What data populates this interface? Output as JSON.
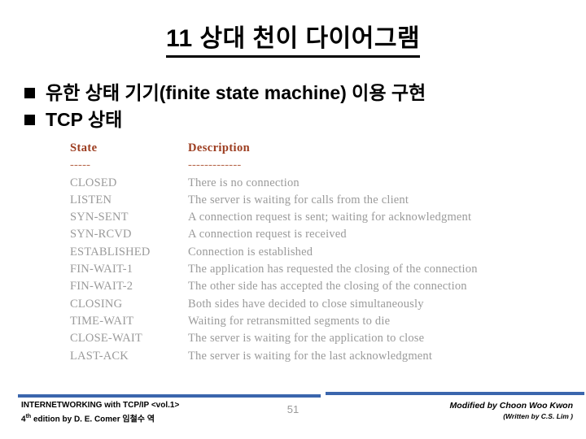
{
  "slide": {
    "title": "11 상대 천이 다이어그램"
  },
  "bullets": [
    {
      "marker": "square-bullet",
      "text": "유한 상태 기기(finite state machine) 이용 구현"
    },
    {
      "marker": "square-bullet",
      "text": "TCP 상태"
    }
  ],
  "table": {
    "headers": {
      "state": "State",
      "description": "Description"
    },
    "separators": {
      "state": "-----",
      "description": "-------------"
    },
    "rows": [
      {
        "state": "CLOSED",
        "description": "There is no connection"
      },
      {
        "state": "LISTEN",
        "description": "The server is waiting for calls from the client"
      },
      {
        "state": "SYN-SENT",
        "description": "A connection request is sent; waiting for acknowledgment"
      },
      {
        "state": "SYN-RCVD",
        "description": "A connection request is received"
      },
      {
        "state": "ESTABLISHED",
        "description": "Connection is established"
      },
      {
        "state": "FIN-WAIT-1",
        "description": "The application has requested the closing of the connection"
      },
      {
        "state": "FIN-WAIT-2",
        "description": "The other side has accepted the closing of the connection"
      },
      {
        "state": "CLOSING",
        "description": "Both sides have decided to close simultaneously"
      },
      {
        "state": "TIME-WAIT",
        "description": "Waiting for retransmitted segments to die"
      },
      {
        "state": "CLOSE-WAIT",
        "description": "The server is waiting for the application to close"
      },
      {
        "state": "LAST-ACK",
        "description": "The server is waiting for the last acknowledgment"
      }
    ]
  },
  "footer": {
    "source_line1": "INTERNETWORKING with TCP/IP <vol.1>",
    "source_line2_prefix": "4",
    "source_line2_sup": "th",
    "source_line2_rest": " edition by D. E. Comer 임철수 역",
    "page_number": "51",
    "credit_main": "Modified by Choon Woo Kwon",
    "credit_sub": "(Written by C.S. Lim )"
  },
  "colors": {
    "header_red": "#9c3c1f",
    "separator_red": "#b86a4e",
    "body_gray": "#9a9a9a",
    "rule_blue": "#3b66ad",
    "text_black": "#000000"
  }
}
